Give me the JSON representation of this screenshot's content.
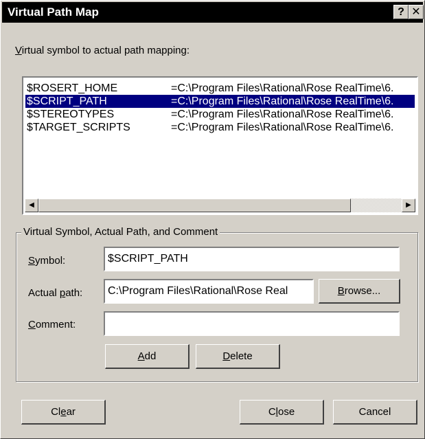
{
  "window": {
    "title": "Virtual Path Map",
    "help_glyph": "?",
    "close_glyph": "✕"
  },
  "mapping_label": {
    "mnemonic": "V",
    "rest": "irtual symbol to actual path mapping:"
  },
  "list": {
    "rows": [
      {
        "symbol": "$ROSERT_HOME",
        "path": "=C:\\Program Files\\Rational\\Rose RealTime\\6.",
        "selected": false
      },
      {
        "symbol": "$SCRIPT_PATH",
        "path": "=C:\\Program Files\\Rational\\Rose RealTime\\6.",
        "selected": true
      },
      {
        "symbol": "$STEREOTYPES",
        "path": "=C:\\Program Files\\Rational\\Rose RealTime\\6.",
        "selected": false
      },
      {
        "symbol": "$TARGET_SCRIPTS",
        "path": "=C:\\Program Files\\Rational\\Rose RealTime\\6.",
        "selected": false
      }
    ],
    "scroll_left_icon": "◀",
    "scroll_right_icon": "▶"
  },
  "group": {
    "legend": "Virtual Symbol, Actual Path, and Comment",
    "symbol_label": {
      "mnemonic": "S",
      "rest": "ymbol:"
    },
    "symbol_value": "$SCRIPT_PATH",
    "path_label": {
      "pre": "Actual ",
      "mnemonic": "p",
      "rest": "ath:"
    },
    "path_value": "C:\\Program Files\\Rational\\Rose Real",
    "browse": {
      "mnemonic": "B",
      "rest": "rowse..."
    },
    "comment_label": {
      "mnemonic": "C",
      "rest": "omment:"
    },
    "comment_value": "",
    "add": {
      "mnemonic": "A",
      "rest": "dd"
    },
    "delete": {
      "mnemonic": "D",
      "rest": "elete"
    }
  },
  "footer": {
    "clear": {
      "pre": "Cl",
      "mnemonic": "e",
      "rest": "ar"
    },
    "close": {
      "pre": "C",
      "mnemonic": "l",
      "rest": "ose"
    },
    "cancel": "Cancel"
  },
  "colors": {
    "dialog_bg": "#d4d0c8",
    "titlebar_bg": "#000000",
    "selection_bg": "#000080",
    "selection_fg": "#ffffff"
  }
}
